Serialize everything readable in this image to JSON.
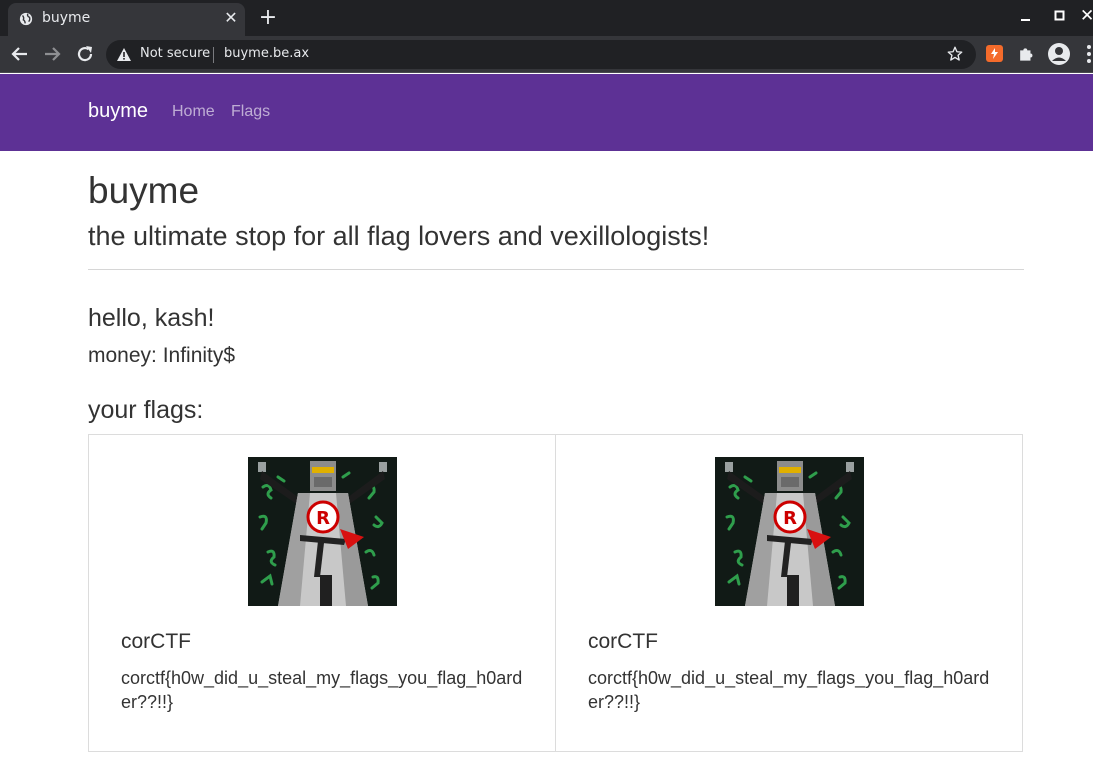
{
  "browser": {
    "tab_title": "buyme",
    "tab_icon": "globe-icon",
    "security_label": "Not secure",
    "url": "buyme.be.ax",
    "colors": {
      "tabstrip": "#202124",
      "toolbar": "#35363a",
      "extension_accent": "#f46b2b"
    }
  },
  "navbar": {
    "brand": "buyme",
    "links": [
      "Home",
      "Flags"
    ],
    "color": "#5d3195"
  },
  "header": {
    "title": "buyme",
    "subtitle": "the ultimate stop for all flag lovers and vexillologists!"
  },
  "user": {
    "greeting": "hello, kash!",
    "money": "money: Infinity$"
  },
  "flags_section": {
    "heading": "your flags:",
    "cards": [
      {
        "name": "corCTF",
        "content": "corctf{h0w_did_u_steal_my_flags_you_flag_h0arder??!!}"
      },
      {
        "name": "corCTF",
        "content": "corctf{h0w_did_u_steal_my_flags_you_flag_h0arder??!!}"
      }
    ]
  }
}
